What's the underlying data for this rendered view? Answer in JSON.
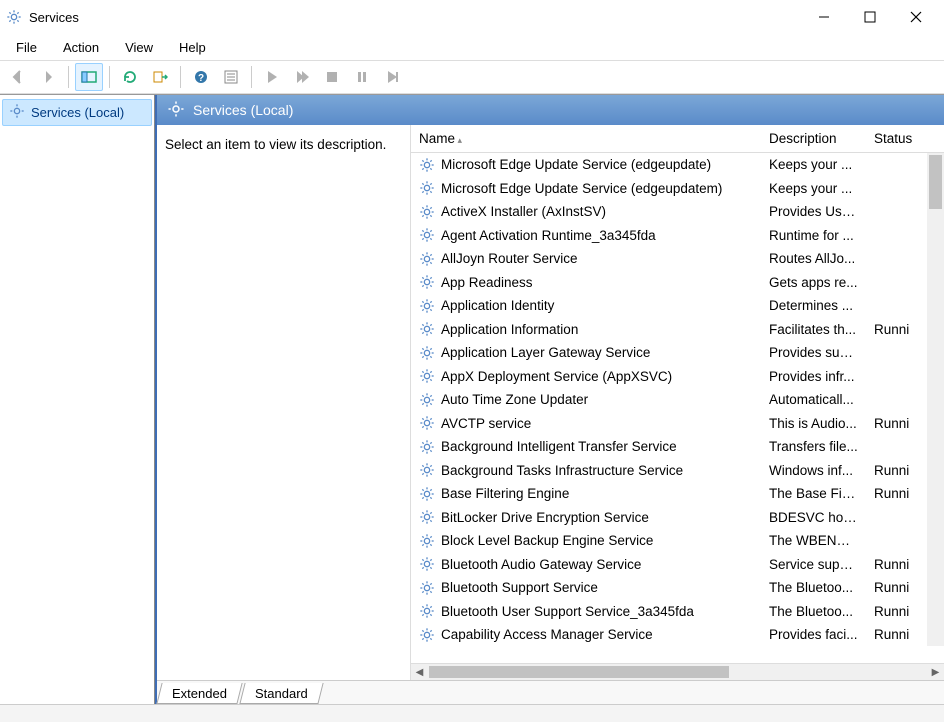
{
  "window": {
    "title": "Services"
  },
  "menu": [
    "File",
    "Action",
    "View",
    "Help"
  ],
  "toolbar": {
    "items": [
      {
        "name": "back-icon",
        "glyph": "arrow-left",
        "disabled": true
      },
      {
        "name": "forward-icon",
        "glyph": "arrow-right",
        "disabled": true
      },
      {
        "sep": true
      },
      {
        "name": "detail-pane-icon",
        "glyph": "pane",
        "active": true
      },
      {
        "sep": true
      },
      {
        "name": "refresh-icon",
        "glyph": "refresh"
      },
      {
        "name": "export-list-icon",
        "glyph": "export"
      },
      {
        "sep": true
      },
      {
        "name": "help-icon",
        "glyph": "help"
      },
      {
        "name": "properties-icon",
        "glyph": "props"
      },
      {
        "sep": true
      },
      {
        "name": "start-service-icon",
        "glyph": "play",
        "disabled": true
      },
      {
        "name": "start-all-icon",
        "glyph": "play2",
        "disabled": true
      },
      {
        "name": "stop-service-icon",
        "glyph": "stop",
        "disabled": true
      },
      {
        "name": "pause-service-icon",
        "glyph": "pause",
        "disabled": true
      },
      {
        "name": "restart-service-icon",
        "glyph": "restart",
        "disabled": true
      }
    ]
  },
  "tree": {
    "root_label": "Services (Local)"
  },
  "right": {
    "header_label": "Services (Local)",
    "description": "Select an item to view its description.",
    "columns": [
      "Name",
      "Description",
      "Status"
    ],
    "services": [
      {
        "name": "Microsoft Edge Update Service (edgeupdate)",
        "desc": "Keeps your ...",
        "status": ""
      },
      {
        "name": "Microsoft Edge Update Service (edgeupdatem)",
        "desc": "Keeps your ...",
        "status": ""
      },
      {
        "name": "ActiveX Installer (AxInstSV)",
        "desc": "Provides Use...",
        "status": ""
      },
      {
        "name": "Agent Activation Runtime_3a345fda",
        "desc": "Runtime for ...",
        "status": ""
      },
      {
        "name": "AllJoyn Router Service",
        "desc": "Routes AllJo...",
        "status": ""
      },
      {
        "name": "App Readiness",
        "desc": "Gets apps re...",
        "status": ""
      },
      {
        "name": "Application Identity",
        "desc": "Determines ...",
        "status": ""
      },
      {
        "name": "Application Information",
        "desc": "Facilitates th...",
        "status": "Runni"
      },
      {
        "name": "Application Layer Gateway Service",
        "desc": "Provides sup...",
        "status": ""
      },
      {
        "name": "AppX Deployment Service (AppXSVC)",
        "desc": "Provides infr...",
        "status": ""
      },
      {
        "name": "Auto Time Zone Updater",
        "desc": "Automaticall...",
        "status": ""
      },
      {
        "name": "AVCTP service",
        "desc": "This is Audio...",
        "status": "Runni"
      },
      {
        "name": "Background Intelligent Transfer Service",
        "desc": "Transfers file...",
        "status": ""
      },
      {
        "name": "Background Tasks Infrastructure Service",
        "desc": "Windows inf...",
        "status": "Runni"
      },
      {
        "name": "Base Filtering Engine",
        "desc": "The Base Filt...",
        "status": "Runni"
      },
      {
        "name": "BitLocker Drive Encryption Service",
        "desc": "BDESVC hos...",
        "status": ""
      },
      {
        "name": "Block Level Backup Engine Service",
        "desc": "The WBENGI...",
        "status": ""
      },
      {
        "name": "Bluetooth Audio Gateway Service",
        "desc": "Service supp...",
        "status": "Runni"
      },
      {
        "name": "Bluetooth Support Service",
        "desc": "The Bluetoo...",
        "status": "Runni"
      },
      {
        "name": "Bluetooth User Support Service_3a345fda",
        "desc": "The Bluetoo...",
        "status": "Runni"
      },
      {
        "name": "Capability Access Manager Service",
        "desc": "Provides faci...",
        "status": "Runni"
      }
    ]
  },
  "tabs": [
    "Extended",
    "Standard"
  ],
  "col_widths": {
    "name": 350,
    "desc": 105,
    "status": 60
  }
}
